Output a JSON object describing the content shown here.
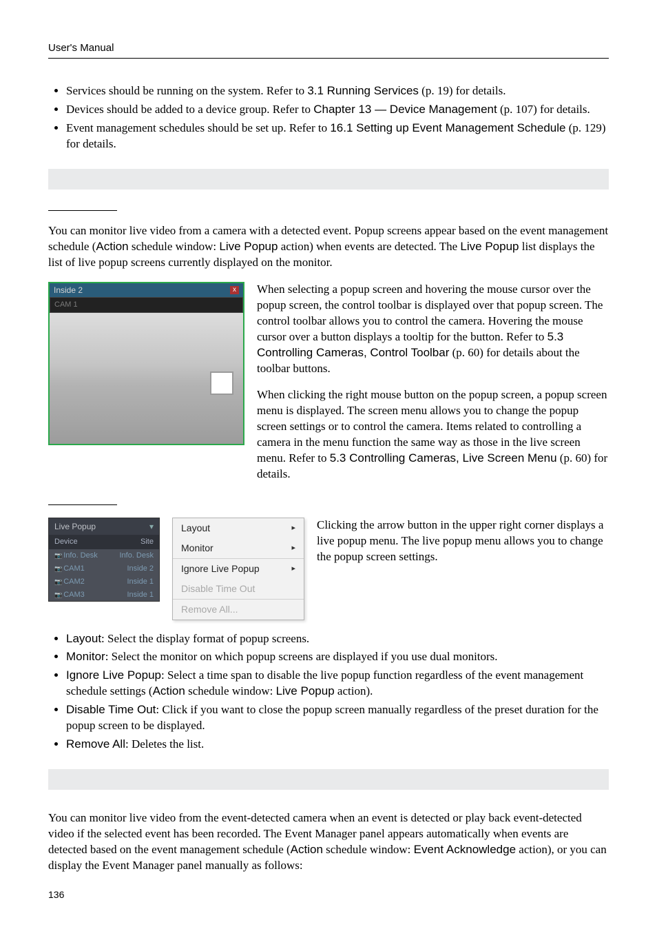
{
  "header": {
    "title": "User's Manual"
  },
  "intro_bullets": [
    {
      "prefix": "Services should be running on the system.  Refer to ",
      "ref": "3.1 Running Services",
      "suffix": " (p. 19) for details."
    },
    {
      "prefix": "Devices should be added to a device group.  Refer to ",
      "ref": "Chapter 13 — Device Management",
      "suffix": " (p. 107) for details."
    },
    {
      "prefix": "Event management schedules should be set up.  Refer to ",
      "ref": "16.1 Setting up Event Management Schedule",
      "suffix": " (p. 129) for details."
    }
  ],
  "s1": {
    "p1a": "You can monitor live video from a camera with a detected event.  Popup screens appear based on the event management schedule (",
    "p1b": "Action",
    "p1c": " schedule window: ",
    "p1d": "Live Popup",
    "p1e": " action) when events are detected.  The ",
    "p1f": "Live Popup",
    "p1g": " list displays the list of live popup screens currently displayed on the monitor."
  },
  "popup": {
    "title": "Inside 2",
    "cam": "CAM 1"
  },
  "s2": {
    "p1a": "When selecting a popup screen and hovering the mouse cursor over the popup screen, the control toolbar is displayed over that popup screen.  The control toolbar allows you to control the camera.  Hovering the mouse cursor over a button displays a tooltip for the button.  Refer to ",
    "p1b": "5.3 Controlling Cameras, Control Toolbar",
    "p1c": " (p. 60) for details about the toolbar buttons.",
    "p2a": "When clicking the right mouse button on the popup screen, a popup screen menu is displayed.  The screen menu allows you to change the popup screen settings or to control the camera.  Items related to controlling a camera in the menu function the same way as those in the live screen menu.  Refer to ",
    "p2b": "5.3 Controlling Cameras, Live Screen Menu",
    "p2c": " (p. 60) for details."
  },
  "live": {
    "title": "Live Popup",
    "col1": "Device",
    "col2": "Site",
    "rows": [
      {
        "d": "Info. Desk",
        "s": "Info. Desk"
      },
      {
        "d": "CAM1",
        "s": "Inside 2"
      },
      {
        "d": "CAM2",
        "s": "Inside 1"
      },
      {
        "d": "CAM3",
        "s": "Inside 1"
      }
    ]
  },
  "menu": {
    "layout": "Layout",
    "monitor": "Monitor",
    "ignore": "Ignore Live Popup",
    "disable": "Disable Time Out",
    "remove": "Remove All..."
  },
  "s3": {
    "p": "Clicking the arrow button in the upper right corner displays a live popup menu.  The live popup menu allows you to change the popup screen settings."
  },
  "opt_bullets": [
    {
      "name": "Layout",
      "text": ": Select the display format of popup screens."
    },
    {
      "name": "Monitor",
      "text": ": Select the monitor on which popup screens are displayed if you use dual monitors."
    },
    {
      "name": "Ignore Live Popup",
      "text_a": ": Select a time span to disable the live popup function regardless of the event management schedule settings (",
      "b1": "Action",
      "text_b": " schedule window: ",
      "b2": "Live Popup",
      "text_c": " action)."
    },
    {
      "name": "Disable Time Out",
      "text": ": Click if you want to close the popup screen manually regardless of the preset duration for the popup screen to be displayed."
    },
    {
      "name": "Remove All",
      "text": ": Deletes the list."
    }
  ],
  "s4": {
    "a": "You can monitor live video from the event-detected camera when an event is detected or play back event-detected video if the selected event has been recorded.  The Event Manager panel appears automatically when events are detected based on the event management schedule (",
    "b": "Action",
    "c": " schedule window: ",
    "d": "Event Acknowledge",
    "e": " action), or you can display the Event Manager panel manually as follows:"
  },
  "page_number": "136"
}
